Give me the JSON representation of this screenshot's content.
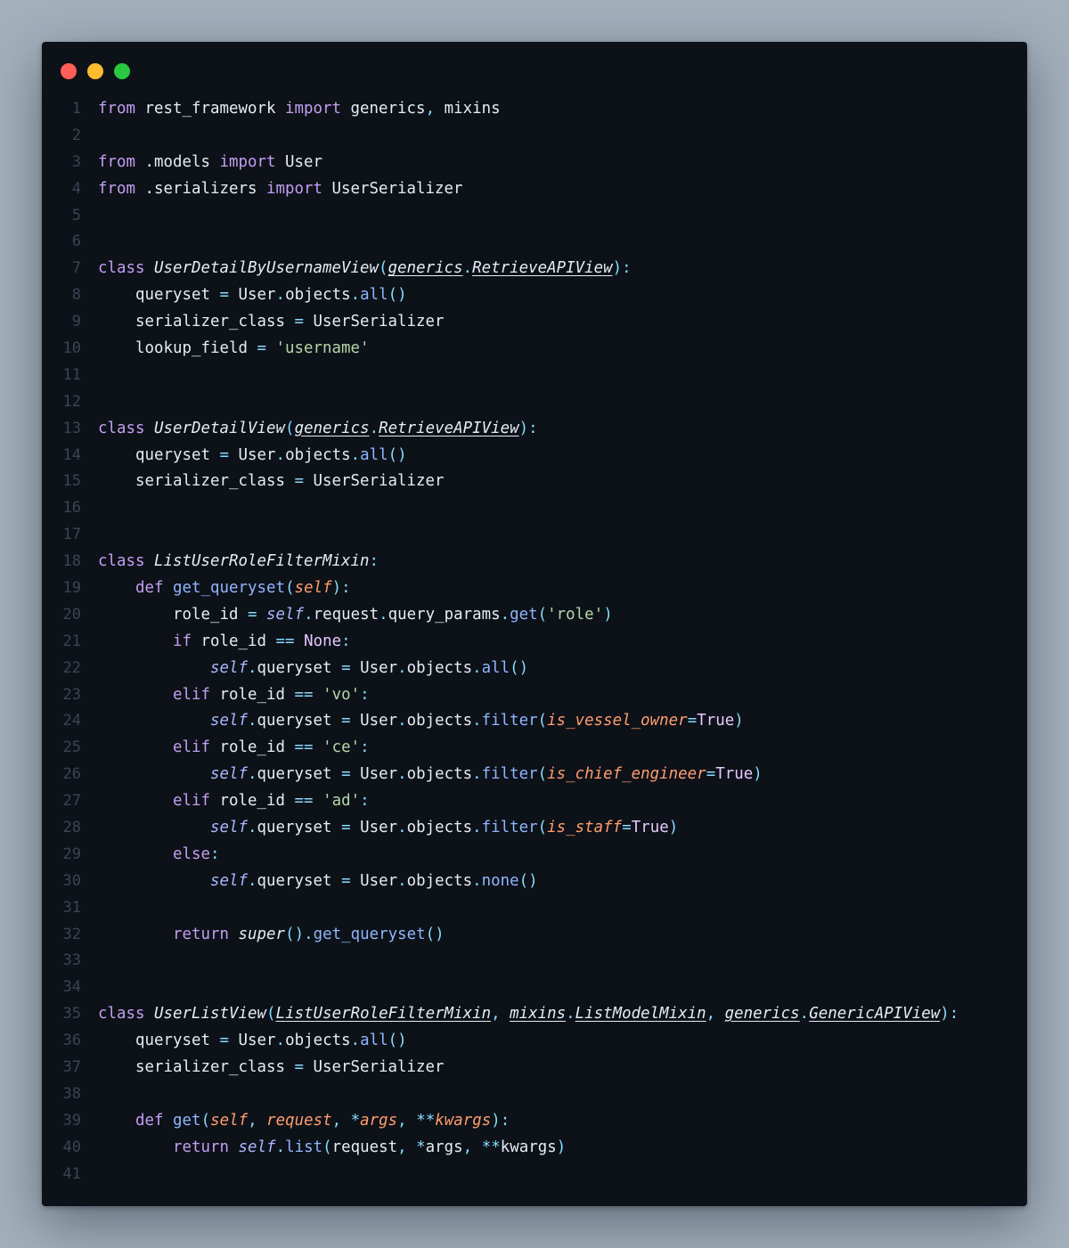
{
  "window": {
    "traffic_lights": [
      {
        "name": "close",
        "color": "#ff5f57"
      },
      {
        "name": "minimize",
        "color": "#febc2e"
      },
      {
        "name": "maximize",
        "color": "#28c840"
      }
    ]
  },
  "editor": {
    "language": "python",
    "lines": [
      {
        "n": "1",
        "tokens": [
          [
            "kw",
            "from"
          ],
          [
            "id",
            " rest_framework "
          ],
          [
            "kw",
            "import"
          ],
          [
            "id",
            " generics"
          ],
          [
            "pu",
            ","
          ],
          [
            "id",
            " mixins"
          ]
        ]
      },
      {
        "n": "2",
        "tokens": []
      },
      {
        "n": "3",
        "tokens": [
          [
            "kw",
            "from"
          ],
          [
            "id",
            " .models "
          ],
          [
            "kw",
            "import"
          ],
          [
            "id",
            " User"
          ]
        ]
      },
      {
        "n": "4",
        "tokens": [
          [
            "kw",
            "from"
          ],
          [
            "id",
            " .serializers "
          ],
          [
            "kw",
            "import"
          ],
          [
            "id",
            " UserSerializer"
          ]
        ]
      },
      {
        "n": "5",
        "tokens": []
      },
      {
        "n": "6",
        "tokens": []
      },
      {
        "n": "7",
        "tokens": [
          [
            "kw",
            "class"
          ],
          [
            "id",
            " "
          ],
          [
            "cls",
            "UserDetailByUsernameView"
          ],
          [
            "pu",
            "("
          ],
          [
            "base",
            "generics"
          ],
          [
            "pu",
            "."
          ],
          [
            "base",
            "RetrieveAPIView"
          ],
          [
            "pu",
            "):"
          ]
        ]
      },
      {
        "n": "8",
        "tokens": [
          [
            "id",
            "    queryset "
          ],
          [
            "op",
            "="
          ],
          [
            "id",
            " User"
          ],
          [
            "pu",
            "."
          ],
          [
            "id",
            "objects"
          ],
          [
            "pu",
            "."
          ],
          [
            "fn",
            "all"
          ],
          [
            "pu",
            "()"
          ]
        ]
      },
      {
        "n": "9",
        "tokens": [
          [
            "id",
            "    serializer_class "
          ],
          [
            "op",
            "="
          ],
          [
            "id",
            " UserSerializer"
          ]
        ]
      },
      {
        "n": "10",
        "tokens": [
          [
            "id",
            "    lookup_field "
          ],
          [
            "op",
            "="
          ],
          [
            "id",
            " "
          ],
          [
            "str",
            "'username'"
          ]
        ]
      },
      {
        "n": "11",
        "tokens": []
      },
      {
        "n": "12",
        "tokens": []
      },
      {
        "n": "13",
        "tokens": [
          [
            "kw",
            "class"
          ],
          [
            "id",
            " "
          ],
          [
            "cls",
            "UserDetailView"
          ],
          [
            "pu",
            "("
          ],
          [
            "base",
            "generics"
          ],
          [
            "pu",
            "."
          ],
          [
            "base",
            "RetrieveAPIView"
          ],
          [
            "pu",
            "):"
          ]
        ]
      },
      {
        "n": "14",
        "tokens": [
          [
            "id",
            "    queryset "
          ],
          [
            "op",
            "="
          ],
          [
            "id",
            " User"
          ],
          [
            "pu",
            "."
          ],
          [
            "id",
            "objects"
          ],
          [
            "pu",
            "."
          ],
          [
            "fn",
            "all"
          ],
          [
            "pu",
            "()"
          ]
        ]
      },
      {
        "n": "15",
        "tokens": [
          [
            "id",
            "    serializer_class "
          ],
          [
            "op",
            "="
          ],
          [
            "id",
            " UserSerializer"
          ]
        ]
      },
      {
        "n": "16",
        "tokens": []
      },
      {
        "n": "17",
        "tokens": []
      },
      {
        "n": "18",
        "tokens": [
          [
            "kw",
            "class"
          ],
          [
            "id",
            " "
          ],
          [
            "cls",
            "ListUserRoleFilterMixin"
          ],
          [
            "pu",
            ":"
          ]
        ]
      },
      {
        "n": "19",
        "tokens": [
          [
            "id",
            "    "
          ],
          [
            "kw",
            "def"
          ],
          [
            "id",
            " "
          ],
          [
            "fn",
            "get_queryset"
          ],
          [
            "pu",
            "("
          ],
          [
            "param",
            "self"
          ],
          [
            "pu",
            "):"
          ]
        ]
      },
      {
        "n": "20",
        "tokens": [
          [
            "id",
            "        role_id "
          ],
          [
            "op",
            "="
          ],
          [
            "id",
            " "
          ],
          [
            "self",
            "self"
          ],
          [
            "pu",
            "."
          ],
          [
            "id",
            "request"
          ],
          [
            "pu",
            "."
          ],
          [
            "id",
            "query_params"
          ],
          [
            "pu",
            "."
          ],
          [
            "fn",
            "get"
          ],
          [
            "pu",
            "("
          ],
          [
            "str",
            "'role'"
          ],
          [
            "pu",
            ")"
          ]
        ]
      },
      {
        "n": "21",
        "tokens": [
          [
            "id",
            "        "
          ],
          [
            "kw",
            "if"
          ],
          [
            "id",
            " role_id "
          ],
          [
            "op",
            "=="
          ],
          [
            "id",
            " "
          ],
          [
            "const",
            "None"
          ],
          [
            "pu",
            ":"
          ]
        ]
      },
      {
        "n": "22",
        "tokens": [
          [
            "id",
            "            "
          ],
          [
            "self",
            "self"
          ],
          [
            "pu",
            "."
          ],
          [
            "id",
            "queryset "
          ],
          [
            "op",
            "="
          ],
          [
            "id",
            " User"
          ],
          [
            "pu",
            "."
          ],
          [
            "id",
            "objects"
          ],
          [
            "pu",
            "."
          ],
          [
            "fn",
            "all"
          ],
          [
            "pu",
            "()"
          ]
        ]
      },
      {
        "n": "23",
        "tokens": [
          [
            "id",
            "        "
          ],
          [
            "kw",
            "elif"
          ],
          [
            "id",
            " role_id "
          ],
          [
            "op",
            "=="
          ],
          [
            "id",
            " "
          ],
          [
            "str",
            "'vo'"
          ],
          [
            "pu",
            ":"
          ]
        ]
      },
      {
        "n": "24",
        "tokens": [
          [
            "id",
            "            "
          ],
          [
            "self",
            "self"
          ],
          [
            "pu",
            "."
          ],
          [
            "id",
            "queryset "
          ],
          [
            "op",
            "="
          ],
          [
            "id",
            " User"
          ],
          [
            "pu",
            "."
          ],
          [
            "id",
            "objects"
          ],
          [
            "pu",
            "."
          ],
          [
            "fn",
            "filter"
          ],
          [
            "pu",
            "("
          ],
          [
            "kwarg",
            "is_vessel_owner"
          ],
          [
            "op",
            "="
          ],
          [
            "const",
            "True"
          ],
          [
            "pu",
            ")"
          ]
        ]
      },
      {
        "n": "25",
        "tokens": [
          [
            "id",
            "        "
          ],
          [
            "kw",
            "elif"
          ],
          [
            "id",
            " role_id "
          ],
          [
            "op",
            "=="
          ],
          [
            "id",
            " "
          ],
          [
            "str",
            "'ce'"
          ],
          [
            "pu",
            ":"
          ]
        ]
      },
      {
        "n": "26",
        "tokens": [
          [
            "id",
            "            "
          ],
          [
            "self",
            "self"
          ],
          [
            "pu",
            "."
          ],
          [
            "id",
            "queryset "
          ],
          [
            "op",
            "="
          ],
          [
            "id",
            " User"
          ],
          [
            "pu",
            "."
          ],
          [
            "id",
            "objects"
          ],
          [
            "pu",
            "."
          ],
          [
            "fn",
            "filter"
          ],
          [
            "pu",
            "("
          ],
          [
            "kwarg",
            "is_chief_engineer"
          ],
          [
            "op",
            "="
          ],
          [
            "const",
            "True"
          ],
          [
            "pu",
            ")"
          ]
        ]
      },
      {
        "n": "27",
        "tokens": [
          [
            "id",
            "        "
          ],
          [
            "kw",
            "elif"
          ],
          [
            "id",
            " role_id "
          ],
          [
            "op",
            "=="
          ],
          [
            "id",
            " "
          ],
          [
            "str",
            "'ad'"
          ],
          [
            "pu",
            ":"
          ]
        ]
      },
      {
        "n": "28",
        "tokens": [
          [
            "id",
            "            "
          ],
          [
            "self",
            "self"
          ],
          [
            "pu",
            "."
          ],
          [
            "id",
            "queryset "
          ],
          [
            "op",
            "="
          ],
          [
            "id",
            " User"
          ],
          [
            "pu",
            "."
          ],
          [
            "id",
            "objects"
          ],
          [
            "pu",
            "."
          ],
          [
            "fn",
            "filter"
          ],
          [
            "pu",
            "("
          ],
          [
            "kwarg",
            "is_staff"
          ],
          [
            "op",
            "="
          ],
          [
            "const",
            "True"
          ],
          [
            "pu",
            ")"
          ]
        ]
      },
      {
        "n": "29",
        "tokens": [
          [
            "id",
            "        "
          ],
          [
            "kw",
            "else"
          ],
          [
            "pu",
            ":"
          ]
        ]
      },
      {
        "n": "30",
        "tokens": [
          [
            "id",
            "            "
          ],
          [
            "self",
            "self"
          ],
          [
            "pu",
            "."
          ],
          [
            "id",
            "queryset "
          ],
          [
            "op",
            "="
          ],
          [
            "id",
            " User"
          ],
          [
            "pu",
            "."
          ],
          [
            "id",
            "objects"
          ],
          [
            "pu",
            "."
          ],
          [
            "fn",
            "none"
          ],
          [
            "pu",
            "()"
          ]
        ]
      },
      {
        "n": "31",
        "tokens": []
      },
      {
        "n": "32",
        "tokens": [
          [
            "id",
            "        "
          ],
          [
            "kw",
            "return"
          ],
          [
            "id",
            " "
          ],
          [
            "bi",
            "super"
          ],
          [
            "pu",
            "()."
          ],
          [
            "fn",
            "get_queryset"
          ],
          [
            "pu",
            "()"
          ]
        ]
      },
      {
        "n": "33",
        "tokens": []
      },
      {
        "n": "34",
        "tokens": []
      },
      {
        "n": "35",
        "tokens": [
          [
            "kw",
            "class"
          ],
          [
            "id",
            " "
          ],
          [
            "cls",
            "UserListView"
          ],
          [
            "pu",
            "("
          ],
          [
            "base",
            "ListUserRoleFilterMixin"
          ],
          [
            "pu",
            ", "
          ],
          [
            "base",
            "mixins"
          ],
          [
            "pu",
            "."
          ],
          [
            "base",
            "ListModelMixin"
          ],
          [
            "pu",
            ", "
          ],
          [
            "base",
            "generics"
          ],
          [
            "pu",
            "."
          ],
          [
            "base",
            "GenericAPIView"
          ],
          [
            "pu",
            "):"
          ]
        ]
      },
      {
        "n": "36",
        "tokens": [
          [
            "id",
            "    queryset "
          ],
          [
            "op",
            "="
          ],
          [
            "id",
            " User"
          ],
          [
            "pu",
            "."
          ],
          [
            "id",
            "objects"
          ],
          [
            "pu",
            "."
          ],
          [
            "fn",
            "all"
          ],
          [
            "pu",
            "()"
          ]
        ]
      },
      {
        "n": "37",
        "tokens": [
          [
            "id",
            "    serializer_class "
          ],
          [
            "op",
            "="
          ],
          [
            "id",
            " UserSerializer"
          ]
        ]
      },
      {
        "n": "38",
        "tokens": []
      },
      {
        "n": "39",
        "tokens": [
          [
            "id",
            "    "
          ],
          [
            "kw",
            "def"
          ],
          [
            "id",
            " "
          ],
          [
            "fn",
            "get"
          ],
          [
            "pu",
            "("
          ],
          [
            "param",
            "self"
          ],
          [
            "pu",
            ", "
          ],
          [
            "param",
            "request"
          ],
          [
            "pu",
            ", "
          ],
          [
            "op",
            "*"
          ],
          [
            "param",
            "args"
          ],
          [
            "pu",
            ", "
          ],
          [
            "op",
            "**"
          ],
          [
            "param",
            "kwargs"
          ],
          [
            "pu",
            "):"
          ]
        ]
      },
      {
        "n": "40",
        "tokens": [
          [
            "id",
            "        "
          ],
          [
            "kw",
            "return"
          ],
          [
            "id",
            " "
          ],
          [
            "self",
            "self"
          ],
          [
            "pu",
            "."
          ],
          [
            "fn",
            "list"
          ],
          [
            "pu",
            "("
          ],
          [
            "id",
            "request"
          ],
          [
            "pu",
            ", "
          ],
          [
            "op",
            "*"
          ],
          [
            "id",
            "args"
          ],
          [
            "pu",
            ", "
          ],
          [
            "op",
            "**"
          ],
          [
            "id",
            "kwargs"
          ],
          [
            "pu",
            ")"
          ]
        ]
      },
      {
        "n": "41",
        "tokens": []
      }
    ]
  }
}
